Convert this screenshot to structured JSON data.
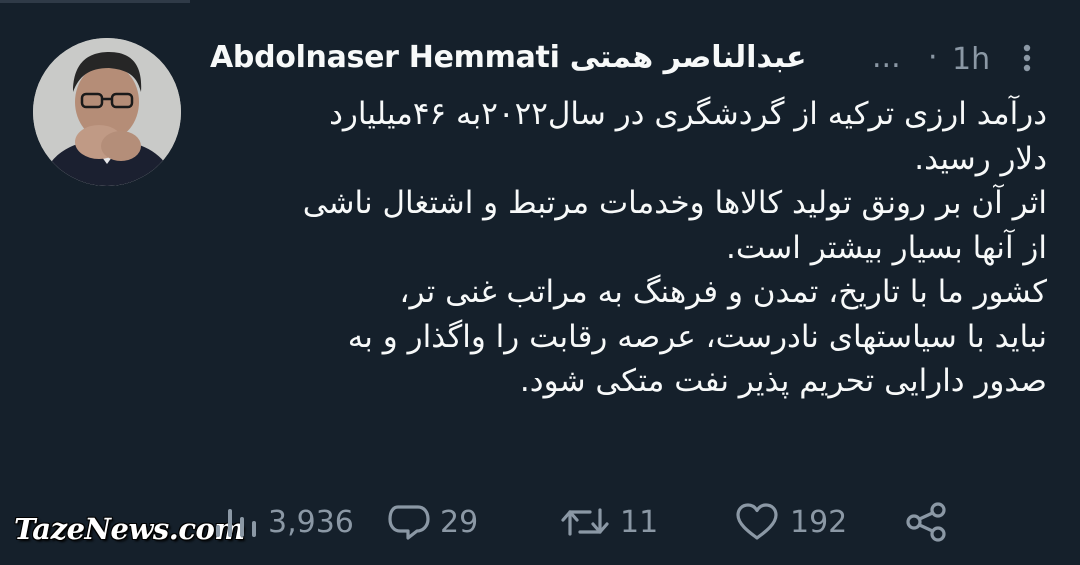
{
  "tweet": {
    "display_name": "Abdolnaser Hemmati عبدالناصر همتی",
    "handle": "...",
    "separator": "·",
    "timestamp": "1h",
    "body": [
      "درآمد ارزی ترکیه از گردشگری در سال۲۰۲۲به ۴۶میلیارد\nدلار رسید.",
      "اثر آن بر رونق تولید کالاها وخدمات مرتبط و اشتغال ناشی\nاز آنها بسیار بیشتر است.",
      "کشور ما با تاریخ، تمدن و فرهنگ به مراتب غنی تر،\nنباید با سیاستهای نادرست، عرصه رقابت را واگذار و به\nصدور دارایی تحریم پذیر نفت متکی شود."
    ],
    "stats": {
      "views": "3,936",
      "replies": "29",
      "retweets": "11",
      "likes": "192"
    }
  },
  "icons": {
    "more": "more-vertical-icon",
    "views": "views-bar-chart-icon",
    "reply": "reply-bubble-icon",
    "retweet": "retweet-icon",
    "like": "heart-icon",
    "share": "share-icon"
  },
  "watermark": "TazeNews.com",
  "colors": {
    "background": "#15202b",
    "text": "#f7f9f9",
    "secondary": "#8b98a5"
  }
}
